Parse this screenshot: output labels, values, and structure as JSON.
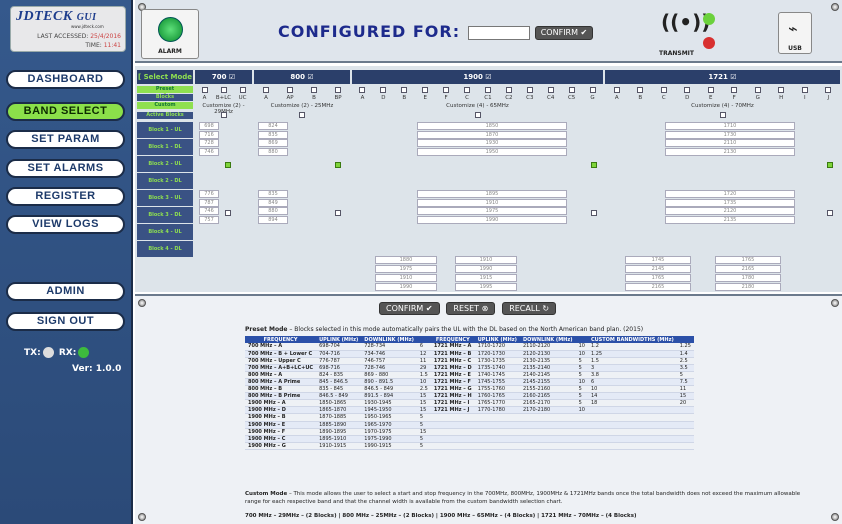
{
  "app": {
    "logo": "JDTECK",
    "logo_suffix": "GUI",
    "logo_sub": "www.jdteck.com",
    "last_accessed_label": "LAST ACCESSED:",
    "last_accessed": "25/4/2016",
    "time_label": "TIME:",
    "time": "11:41"
  },
  "nav": {
    "items": [
      "DASHBOARD",
      "BAND SELECT",
      "SET PARAM",
      "SET ALARMS",
      "REGISTER",
      "VIEW LOGS"
    ],
    "active": "BAND SELECT",
    "admin": "ADMIN",
    "signout": "SIGN OUT"
  },
  "status": {
    "tx": "TX:",
    "rx": "RX:",
    "version": "Ver: 1.0.0"
  },
  "top": {
    "alarm": "ALARM",
    "configured_for": "CONFIGURED FOR:",
    "confirm": "CONFIRM",
    "transmit": "TRANSMIT",
    "usb": "USB"
  },
  "grid": {
    "select_mode": "[ Select Mode ]",
    "preset": "Preset",
    "blocks": "Blocks",
    "custom": "Custom",
    "active_blocks": "Active Blocks",
    "bands": [
      {
        "name": "700",
        "blocks": [
          "A",
          "B+LC",
          "UC"
        ],
        "custom": "Customize (2) - 29MHz"
      },
      {
        "name": "800",
        "blocks": [
          "A",
          "AP",
          "B",
          "BP"
        ],
        "custom": "Customize (2) - 25MHz"
      },
      {
        "name": "1900",
        "blocks": [
          "A",
          "D",
          "B",
          "E",
          "F",
          "C",
          "C1",
          "C2",
          "C3",
          "C4",
          "C5",
          "G"
        ],
        "custom": "Customize (4) - 65MHz"
      },
      {
        "name": "1721",
        "blocks": [
          "A",
          "B",
          "C",
          "D",
          "E",
          "F",
          "G",
          "H",
          "I",
          "J"
        ],
        "custom": "Customize (4) - 70MHz"
      }
    ],
    "row_labels": [
      "Block 1 - UL",
      "Block 1 - DL",
      "Block 2 - UL",
      "Block 2 - DL",
      "Block 3 - UL",
      "Block 3 - DL",
      "Block 4 - UL",
      "Block 4 - DL"
    ],
    "b700": [
      "698",
      "716",
      "728",
      "746",
      "776",
      "787",
      "746",
      "757"
    ],
    "b800": [
      "824",
      "835",
      "869",
      "880",
      "835",
      "849",
      "880",
      "894"
    ],
    "b1900": [
      "1850",
      "1870",
      "1930",
      "1950",
      "1895",
      "1910",
      "1975",
      "1990"
    ],
    "b1900_extra": [
      [
        "1880",
        "1910"
      ],
      [
        "1975",
        "1990"
      ],
      [
        "1910",
        "1915"
      ],
      [
        "1990",
        "1995"
      ]
    ],
    "b1721": [
      "1710",
      "1730",
      "2110",
      "2130",
      "1720",
      "1735",
      "2120",
      "2135"
    ],
    "b1721_extra": [
      [
        "1745",
        "1765"
      ],
      [
        "2145",
        "2165"
      ],
      [
        "1765",
        "1780"
      ],
      [
        "2165",
        "2180"
      ]
    ]
  },
  "buttons": {
    "confirm": "CONFIRM",
    "reset": "RESET",
    "recall": "RECALL"
  },
  "preset_mode": {
    "title": "Preset Mode",
    "text": " – Blocks selected in this mode automatically pairs the UL with the DL based on the North American band plan. (2015)"
  },
  "table": {
    "headers": [
      "FREQUENCY",
      "UPLINK (MHz)",
      "DOWNLINK (MHz)",
      "",
      "FREQUENCY",
      "UPLINK (MHz)",
      "DOWNLINK (MHz)",
      "",
      "CUSTOM BANDWIDTHS (MHz)",
      ""
    ],
    "rows": [
      [
        "700 MHz – A",
        "698-704",
        "728-734",
        "6",
        "1721 MHz – A",
        "1710-1720",
        "2110-2120",
        "10",
        "1.2",
        "1.25"
      ],
      [
        "700 MHz – B + Lower C",
        "704-716",
        "734-746",
        "12",
        "1721 MHz – B",
        "1720-1730",
        "2120-2130",
        "10",
        "1.25",
        "1.4"
      ],
      [
        "700 MHz – Upper C",
        "776-787",
        "746-757",
        "11",
        "1721 MHz – C",
        "1730-1735",
        "2130-2135",
        "5",
        "1.5",
        "2.5"
      ],
      [
        "700 MHz – A+B+LC+UC",
        "698-716",
        "728-746",
        "29",
        "1721 MHz – D",
        "1735-1740",
        "2135-2140",
        "5",
        "3",
        "3.5"
      ],
      [
        "800 MHz – A",
        "824 - 835",
        "869 - 880",
        "1.5",
        "1721 MHz – E",
        "1740-1745",
        "2140-2145",
        "5",
        "3.8",
        "5"
      ],
      [
        "800 MHz – A Prime",
        "845 - 846.5",
        "890 - 891.5",
        "10",
        "1721 MHz – F",
        "1745-1755",
        "2145-2155",
        "10",
        "6",
        "7.5"
      ],
      [
        "800 MHz – B",
        "835 - 845",
        "846.5 - 849",
        "2.5",
        "1721 MHz – G",
        "1755-1760",
        "2155-2160",
        "5",
        "10",
        "11"
      ],
      [
        "800 MHz – B Prime",
        "846.5 - 849",
        "891.5 - 894",
        "15",
        "1721 MHz – H",
        "1760-1765",
        "2160-2165",
        "5",
        "14",
        "15"
      ],
      [
        "1900 MHz – A",
        "1850-1865",
        "1930-1945",
        "15",
        "1721 MHz – I",
        "1765-1770",
        "2165-2170",
        "5",
        "18",
        "20"
      ],
      [
        "1900 MHz – D",
        "1865-1870",
        "1945-1950",
        "15",
        "1721 MHz – J",
        "1770-1780",
        "2170-2180",
        "10",
        "",
        ""
      ],
      [
        "1900 MHz – B",
        "1870-1885",
        "1950-1965",
        "5",
        "",
        "",
        "",
        "",
        "",
        ""
      ],
      [
        "1900 MHz – E",
        "1885-1890",
        "1965-1970",
        "5",
        "",
        "",
        "",
        "",
        "",
        ""
      ],
      [
        "1900 MHz – F",
        "1890-1895",
        "1970-1975",
        "15",
        "",
        "",
        "",
        "",
        "",
        ""
      ],
      [
        "1900 MHz – C",
        "1895-1910",
        "1975-1990",
        "5",
        "",
        "",
        "",
        "",
        "",
        ""
      ],
      [
        "1900 MHz – G",
        "1910-1915",
        "1990-1915",
        "5",
        "",
        "",
        "",
        "",
        "",
        ""
      ]
    ]
  },
  "custom_mode": {
    "title": "Custom Mode",
    "text": " – This mode allows the user to select a start and stop frequency in the 700MHz, 800MHz, 1900MHz & 1721MHz bands once the total bandwidth does not exceed the maximum allowable range for each respective band and that the channel width is available from the custom bandwidth selection chart."
  },
  "footer": "700 MHz – 29MHz – (2 Blocks) | 800 MHz – 25MHz – (2 Blocks) | 1900 MHz – 65MHz – (4 Blocks) | 1721 MHz – 70MHz – (4 Blocks)"
}
